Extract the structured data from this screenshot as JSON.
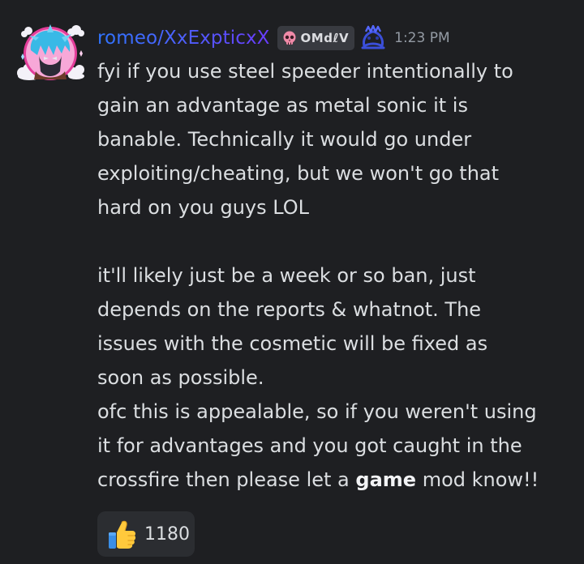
{
  "message": {
    "author": "romeo/XxExpticxX",
    "tag": {
      "icon": "skull-icon",
      "text": "OMdℓV"
    },
    "decoration_icon": "crown-icon",
    "timestamp": "1:23 PM",
    "paragraph1_lines": [
      "fyi if you use steel speeder intentionally to",
      "gain an advantage as metal sonic it is",
      "banable. Technically it would go under",
      "exploiting/cheating, but we won't go that",
      "hard on you guys LOL"
    ],
    "paragraph2_lines": [
      "it'll likely just be a week or so ban, just",
      "depends on the reports & whatnot. The",
      "issues with the cosmetic will be fixed as",
      "soon as possible."
    ],
    "paragraph3_lines": [
      "ofc this is appealable, so if you weren't using",
      "it for advantages and you got caught in the"
    ],
    "paragraph3_last": {
      "before": "crossfire then please let a ",
      "bold": "game",
      "after": " mod know!!"
    }
  },
  "reaction": {
    "emoji": "thumbs-up-icon",
    "count": "1180"
  },
  "colors": {
    "background": "#1e1f22",
    "username_gradient_start": "#2f74ff",
    "username_gradient_end": "#6a3cff",
    "text": "#dbdee1",
    "timestamp": "#949ba4",
    "tag_background": "#383a40",
    "reaction_background": "#2b2d31"
  }
}
